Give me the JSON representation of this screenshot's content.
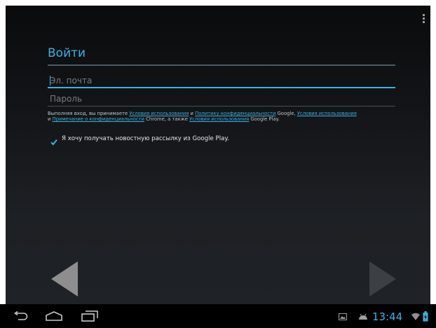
{
  "signin": {
    "title": "Войти",
    "email_placeholder": "Эл. почта",
    "password_placeholder": "Пароль"
  },
  "terms": {
    "part1": "Выполняя вход, вы принимаете ",
    "link1": "Условия использования",
    "part2": " и ",
    "link2": "Политику конфиденциальности",
    "part3": " Google, ",
    "link3": "Условия использования",
    "part4": " и ",
    "link4": "Примечание о конфиденциальности",
    "part5": " Chrome, а также ",
    "link5": "Условия использования",
    "part6": " Google Play."
  },
  "newsletter": {
    "label": "Я хочу получать новостную рассылку из Google Play.",
    "checked": true
  },
  "status": {
    "time": "13:44"
  },
  "icons": {
    "menu": "overflow-menu-icon",
    "back_nav": "back-icon",
    "home_nav": "home-icon",
    "recents_nav": "recent-apps-icon",
    "gallery": "gallery-notification-icon",
    "android": "android-notification-icon",
    "wifi": "wifi-icon",
    "battery": "battery-icon"
  },
  "colors": {
    "accent": "#33b5e5",
    "background": "#1a1d21",
    "text": "#e6e6e6"
  }
}
